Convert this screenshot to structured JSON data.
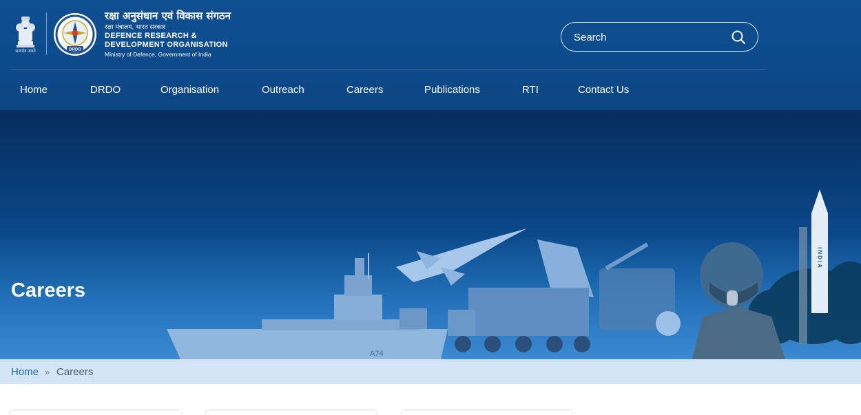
{
  "header": {
    "emblem_caption": "सत्यमेव जयते",
    "org_name_hindi": "रक्षा अनुसंधान एवं विकास संगठन",
    "ministry_hindi": "रक्षा मंत्रालय, भारत सरकार",
    "org_name_english_line1": "DEFENCE RESEARCH &",
    "org_name_english_line2": "DEVELOPMENT ORGANISATION",
    "ministry_english": "Ministry of Defence, Government of India",
    "logo_label": "DRDO"
  },
  "search": {
    "placeholder": "Search",
    "value": "",
    "icon": "search-icon"
  },
  "nav": {
    "items": [
      {
        "label": "Home"
      },
      {
        "label": "DRDO"
      },
      {
        "label": "Organisation"
      },
      {
        "label": "Outreach"
      },
      {
        "label": "Careers"
      },
      {
        "label": "Publications"
      },
      {
        "label": "RTI"
      },
      {
        "label": "Contact Us"
      }
    ]
  },
  "banner": {
    "title": "Careers",
    "ship_label": "A74",
    "missile_label": "INDIA"
  },
  "breadcrumb": {
    "home": "Home",
    "separator": "»",
    "current": "Careers"
  },
  "colors": {
    "header_bg": "#0c4a8a",
    "breadcrumb_bg": "#d3e4f6",
    "breadcrumb_link": "#1f6aa5",
    "text_on_dark": "#ffffff"
  }
}
